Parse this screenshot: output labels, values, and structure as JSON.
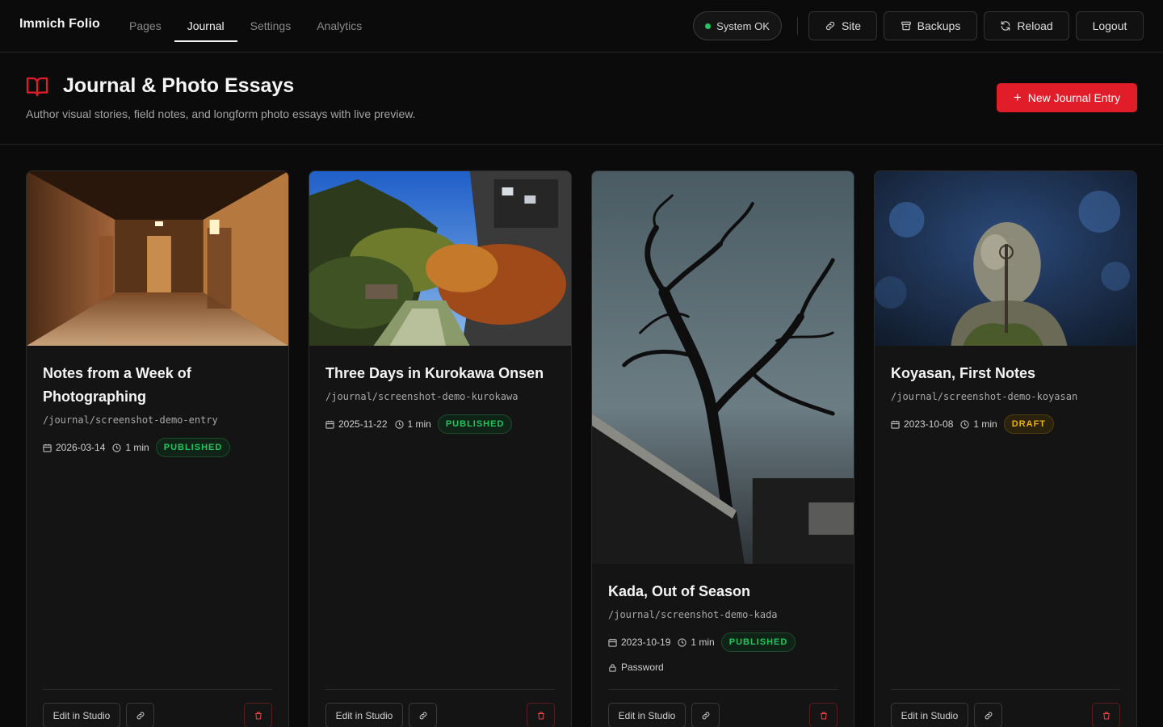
{
  "app": {
    "brand": "Immich Folio"
  },
  "nav": {
    "items": [
      {
        "label": "Pages"
      },
      {
        "label": "Journal"
      },
      {
        "label": "Settings"
      },
      {
        "label": "Analytics"
      }
    ],
    "active": "Journal"
  },
  "topbar": {
    "status": "System OK",
    "site": "Site",
    "backups": "Backups",
    "reload": "Reload",
    "logout": "Logout"
  },
  "header": {
    "title": "Journal & Photo Essays",
    "subtitle": "Author visual stories, field notes, and longform photo essays with live preview.",
    "new_entry": "New Journal Entry"
  },
  "colors": {
    "accent": "#e11d2a",
    "published": "#22c55e",
    "draft": "#eab308",
    "status_ok": "#22c55e"
  },
  "cards": [
    {
      "title": "Notes from a Week of Photographing",
      "slug": "/journal/screenshot-demo-entry",
      "date": "2026-03-14",
      "read_time": "1 min",
      "status": "PUBLISHED",
      "image": "hallway",
      "edit_label": "Edit in Studio"
    },
    {
      "title": "Three Days in Kurokawa Onsen",
      "slug": "/journal/screenshot-demo-kurokawa",
      "date": "2025-11-22",
      "read_time": "1 min",
      "status": "PUBLISHED",
      "image": "onsen-valley",
      "edit_label": "Edit in Studio"
    },
    {
      "title": "Kada, Out of Season",
      "slug": "/journal/screenshot-demo-kada",
      "date": "2023-10-19",
      "read_time": "1 min",
      "status": "PUBLISHED",
      "protection": "Password",
      "image": "bare-tree",
      "edit_label": "Edit in Studio"
    },
    {
      "title": "Koyasan, First Notes",
      "slug": "/journal/screenshot-demo-koyasan",
      "date": "2023-10-08",
      "read_time": "1 min",
      "status": "DRAFT",
      "image": "stone-statue",
      "edit_label": "Edit in Studio"
    }
  ]
}
